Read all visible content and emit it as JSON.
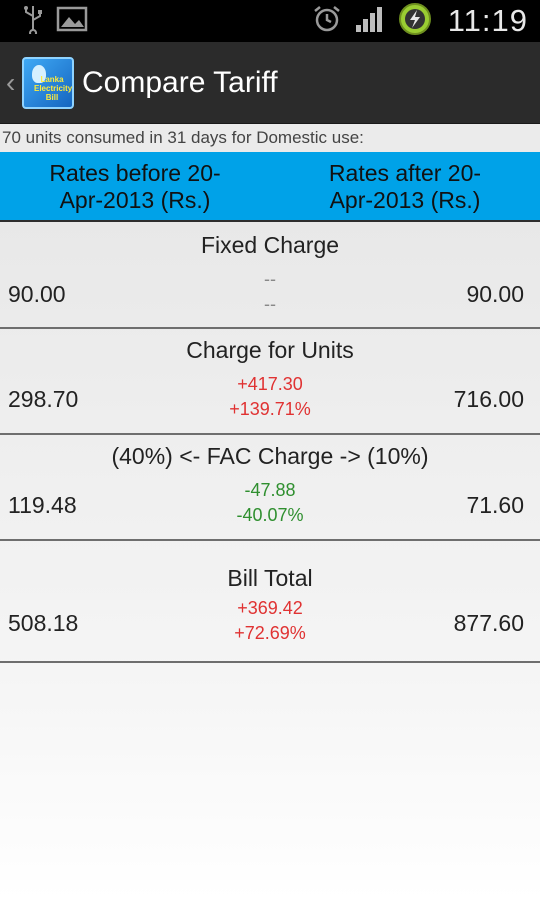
{
  "status_bar": {
    "time": "11:19",
    "icons": [
      "usb-icon",
      "image-icon",
      "alarm-icon",
      "signal-icon",
      "battery-charging-icon"
    ]
  },
  "action_bar": {
    "title": "Compare Tariff",
    "app_icon_text": "Lanka Electricity Bill"
  },
  "info_line": "70 units consumed in 31 days for Domestic use:",
  "header": {
    "before_label": "Rates before 20-Apr-2013 (Rs.)",
    "before_line1": "Rates before 20-",
    "before_line2": "Apr-2013 (Rs.)",
    "after_line1": "Rates after 20-",
    "after_line2": "Apr-2013 (Rs.)"
  },
  "sections": {
    "fixed": {
      "title": "Fixed Charge",
      "left": "90.00",
      "right": "90.00",
      "diff_amount": "--",
      "diff_percent": "--"
    },
    "units": {
      "title": "Charge for Units",
      "left": "298.70",
      "right": "716.00",
      "diff_amount": "+417.30",
      "diff_percent": "+139.71%"
    },
    "fac": {
      "title": "(40%) <- FAC Charge -> (10%)",
      "left": "119.48",
      "right": "71.60",
      "diff_amount": "-47.88",
      "diff_percent": "-40.07%"
    },
    "total": {
      "title": "Bill Total",
      "left": "508.18",
      "right": "877.60",
      "diff_amount": "+369.42",
      "diff_percent": "+72.69%"
    }
  },
  "colors": {
    "header_band": "#00a2e8",
    "increase": "#e03232",
    "decrease": "#2f8f2f",
    "action_bar": "#2b2b2b"
  }
}
